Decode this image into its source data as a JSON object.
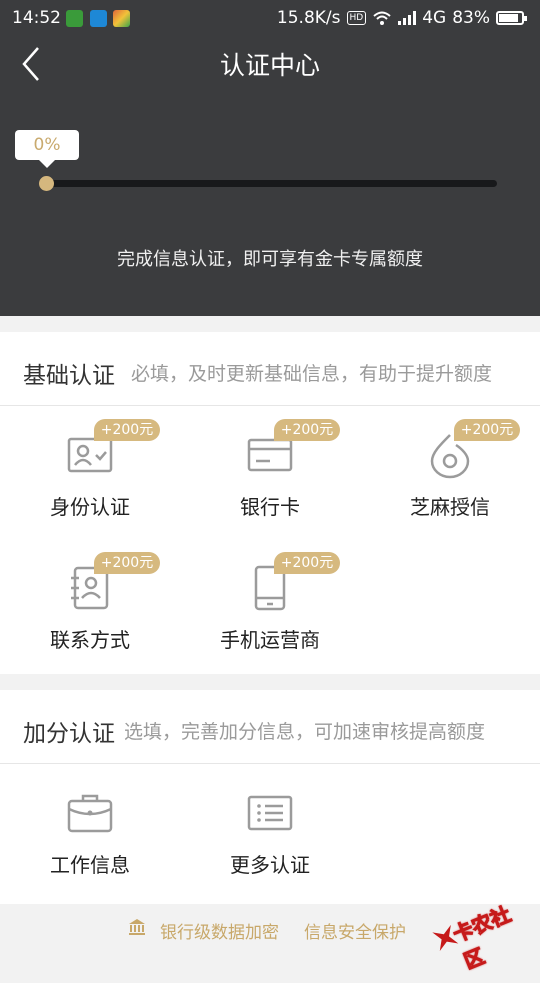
{
  "status_bar": {
    "time": "14:52",
    "speed": "15.8K/s",
    "hd": "HD",
    "network": "4G",
    "battery": "83%",
    "app_icons": [
      {
        "name": "green-app-icon",
        "color": "#3a9b3a"
      },
      {
        "name": "blue-app-icon",
        "color": "#1e88d6"
      },
      {
        "name": "colorful-app-icon",
        "color": "#e0663a"
      }
    ]
  },
  "nav": {
    "title": "认证中心",
    "back_icon": "chevron-left-icon"
  },
  "progress": {
    "percent_label": "0%",
    "value": 0,
    "message": "完成信息认证，即可享有金卡专属额度"
  },
  "basic_section": {
    "title": "基础认证",
    "hint": "必填，及时更新基础信息，有助于提升额度",
    "items": [
      {
        "label": "身份认证",
        "badge": "+200元",
        "icon": "id-card-icon"
      },
      {
        "label": "银行卡",
        "badge": "+200元",
        "icon": "bank-card-icon"
      },
      {
        "label": "芝麻授信",
        "badge": "+200元",
        "icon": "sesame-icon"
      },
      {
        "label": "联系方式",
        "badge": "+200元",
        "icon": "contacts-book-icon"
      },
      {
        "label": "手机运营商",
        "badge": "+200元",
        "icon": "mobile-phone-icon"
      }
    ]
  },
  "bonus_section": {
    "title": "加分认证",
    "hint": "选填，完善加分信息，可加速审核提高额度",
    "items": [
      {
        "label": "工作信息",
        "icon": "briefcase-icon"
      },
      {
        "label": "更多认证",
        "icon": "list-icon"
      }
    ]
  },
  "footer": {
    "icon": "bank-building-icon",
    "text1": "银行级数据加密",
    "text2": "信息安全保护"
  },
  "watermark": {
    "text": "卡农社区"
  },
  "colors": {
    "header_bg": "#3b3c3e",
    "accent_gold": "#d6b97f",
    "footer_gold": "#c8a86a",
    "icon_gray": "#9b9b9b"
  }
}
